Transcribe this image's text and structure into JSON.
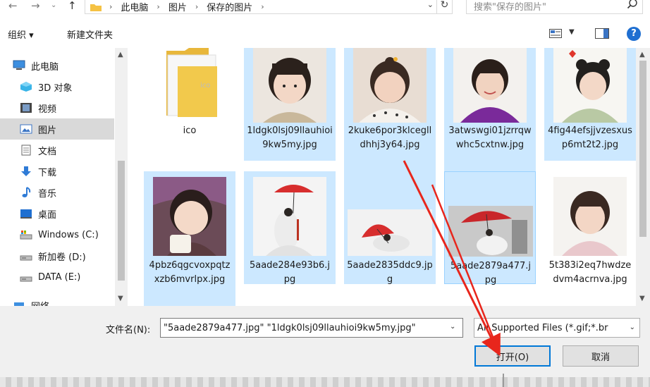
{
  "address": {
    "crumbs": [
      "此电脑",
      "图片",
      "保存的图片"
    ],
    "search_placeholder": "搜索\"保存的图片\""
  },
  "toolbar": {
    "organize": "组织 ▾",
    "new_folder": "新建文件夹"
  },
  "nav": {
    "items": [
      {
        "label": "此电脑",
        "icon": "computer-icon"
      },
      {
        "label": "3D 对象",
        "icon": "3d-objects-icon"
      },
      {
        "label": "视频",
        "icon": "video-icon"
      },
      {
        "label": "图片",
        "icon": "pictures-icon",
        "selected": true
      },
      {
        "label": "文档",
        "icon": "documents-icon"
      },
      {
        "label": "下载",
        "icon": "download-icon"
      },
      {
        "label": "音乐",
        "icon": "music-icon"
      },
      {
        "label": "桌面",
        "icon": "desktop-icon"
      },
      {
        "label": "Windows (C:)",
        "icon": "drive-c-icon"
      },
      {
        "label": "新加卷 (D:)",
        "icon": "drive-d-icon"
      },
      {
        "label": "DATA (E:)",
        "icon": "drive-e-icon"
      },
      {
        "label": "网络",
        "icon": "network-icon"
      }
    ]
  },
  "files": [
    {
      "name": "ico",
      "kind": "folder",
      "selected": false
    },
    {
      "name": "1ldgk0lsj09llauhioi9kw5my.jpg",
      "kind": "image",
      "selected": true
    },
    {
      "name": "2kuke6por3klceglldhhj3y64.jpg",
      "kind": "image",
      "selected": true
    },
    {
      "name": "3atwswgi01jzrrqwwhc5cxtnw.jpg",
      "kind": "image",
      "selected": true
    },
    {
      "name": "4fig44efsjjvzesxusp6mt2t2.jpg",
      "kind": "image",
      "selected": true
    },
    {
      "name": "4pbz6qgcvoxpqtzxzb6mvrlpx.jpg",
      "kind": "image",
      "selected": true
    },
    {
      "name": "5aade284e93b6.jpg",
      "kind": "image",
      "selected": true
    },
    {
      "name": "5aade2835ddc9.jpg",
      "kind": "image",
      "selected": true
    },
    {
      "name": "5aade2879a477.jpg",
      "kind": "image",
      "selected": true,
      "focused": true
    },
    {
      "name": "5t383i2eq7hwdzedvm4acrnva.jpg",
      "kind": "image",
      "selected": false
    }
  ],
  "bottom": {
    "filename_label": "文件名(N):",
    "filename_value": "\"5aade2879a477.jpg\" \"1ldgk0lsj09llauhioi9kw5my.jpg\"",
    "filter_value": "All Supported Files (*.gif;*.br",
    "open_label": "打开(O)",
    "cancel_label": "取消"
  },
  "colors": {
    "selection": "#cce8ff",
    "accent": "#0078d7",
    "arrow": "#e8261c"
  }
}
